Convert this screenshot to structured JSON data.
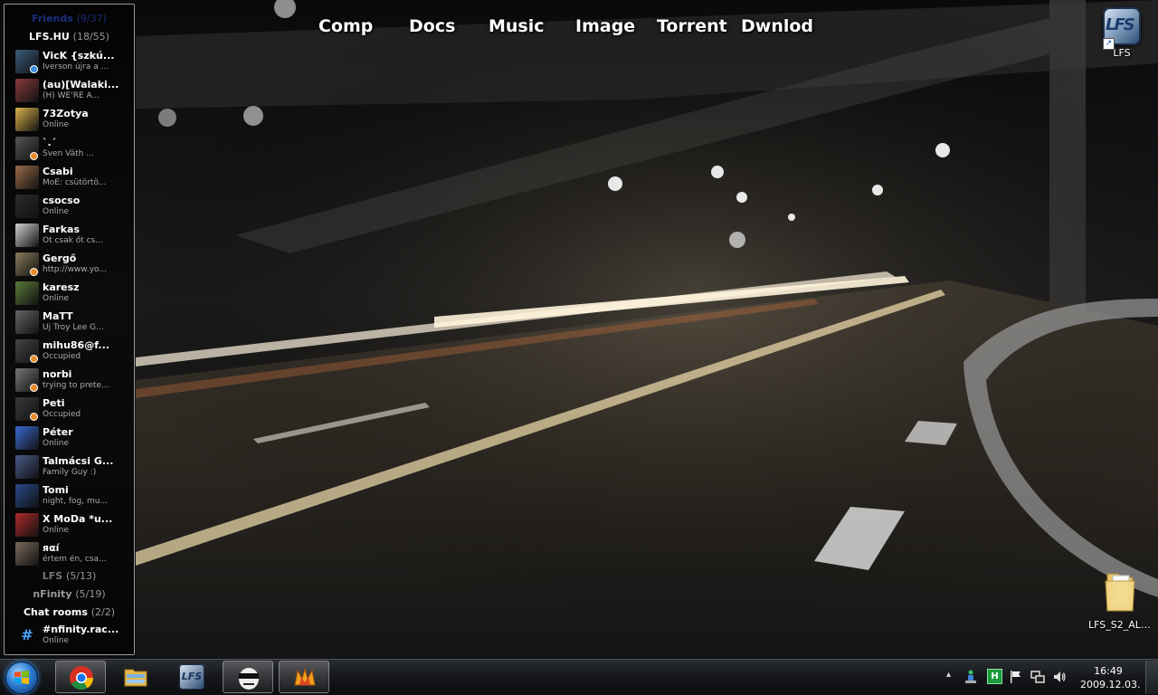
{
  "desktop_links": [
    {
      "label": "Comp"
    },
    {
      "label": "Docs"
    },
    {
      "label": "Music"
    },
    {
      "label": "Image"
    },
    {
      "label": "Torrent"
    },
    {
      "label": "Dwnlod"
    }
  ],
  "desktop_icons": [
    {
      "label": "LFS",
      "icon": "lfs-shortcut-icon"
    },
    {
      "label": "LFS_S2_ALP...",
      "icon": "folder-icon"
    }
  ],
  "buddy_list": {
    "groups": {
      "friends": {
        "name": "Friends",
        "count": "(9/37)"
      },
      "lfshu": {
        "name": "LFS.HU",
        "count": "(18/55)"
      },
      "lfs": {
        "name": "LFS",
        "count": "(5/13)"
      },
      "nfinity": {
        "name": "nFinity",
        "count": "(5/19)"
      },
      "chatrooms": {
        "name": "Chat rooms",
        "count": "(2/2)"
      }
    },
    "contacts": [
      {
        "name": "VicK  {szkú...",
        "status": "Iverson újra a ...",
        "color": "#3a5a7a",
        "badge": "#3a8fe0"
      },
      {
        "name": "(au)[Walaki...",
        "status": "(H) WE'RE A...",
        "color": "#8a3b3b",
        "badge": ""
      },
      {
        "name": "73Zotya",
        "status": "Online",
        "color": "#d9b34a",
        "badge": ""
      },
      {
        "name": "`.´",
        "status": "Sven Väth ...",
        "color": "#555555",
        "badge": "#e88a2a"
      },
      {
        "name": "Csabi",
        "status": "MoE: csütörtö...",
        "color": "#9a6b4a",
        "badge": ""
      },
      {
        "name": "csocso",
        "status": "Online",
        "color": "#2c2c2c",
        "badge": ""
      },
      {
        "name": "Farkas",
        "status": "Őt csak őt cs...",
        "color": "#cfcfcf",
        "badge": ""
      },
      {
        "name": "Gergő",
        "status": "http://www.yo...",
        "color": "#8a7a5a",
        "badge": "#e88a2a"
      },
      {
        "name": "karesz",
        "status": "Online",
        "color": "#5a7a3a",
        "badge": ""
      },
      {
        "name": "MaTT",
        "status": "Új Troy Lee G...",
        "color": "#666666",
        "badge": ""
      },
      {
        "name": "mihu86@f...",
        "status": "Occupied",
        "color": "#444444",
        "badge": "#e88a2a"
      },
      {
        "name": "norbi",
        "status": "trying to prete...",
        "color": "#777777",
        "badge": "#e88a2a"
      },
      {
        "name": "Peti",
        "status": "Occupied",
        "color": "#3a3a3a",
        "badge": "#e88a2a"
      },
      {
        "name": "Péter",
        "status": "Online",
        "color": "#3a6ad0",
        "badge": ""
      },
      {
        "name": "Talmácsi G...",
        "status": "Family Guy :)",
        "color": "#4a5a8a",
        "badge": ""
      },
      {
        "name": "Tomi",
        "status": "night, fog, mu...",
        "color": "#2a4a8a",
        "badge": ""
      },
      {
        "name": "X MoDa *u...",
        "status": "Online",
        "color": "#b02a2a",
        "badge": ""
      },
      {
        "name": "яαí",
        "status": "értem én, csa...",
        "color": "#7a6a5a",
        "badge": ""
      }
    ],
    "chat_rooms": [
      {
        "name": "#nfinity.rac...",
        "status": "Online"
      }
    ]
  },
  "taskbar": {
    "apps": [
      {
        "name": "chrome-icon",
        "active": true
      },
      {
        "name": "explorer-icon",
        "active": false
      },
      {
        "name": "lfs-icon",
        "active": false
      },
      {
        "name": "mask-app-icon",
        "active": true
      },
      {
        "name": "miranda-icon",
        "active": true
      }
    ],
    "tray": {
      "show_hidden": "▴",
      "clock_time": "16:49",
      "clock_date": "2009.12.03."
    }
  }
}
